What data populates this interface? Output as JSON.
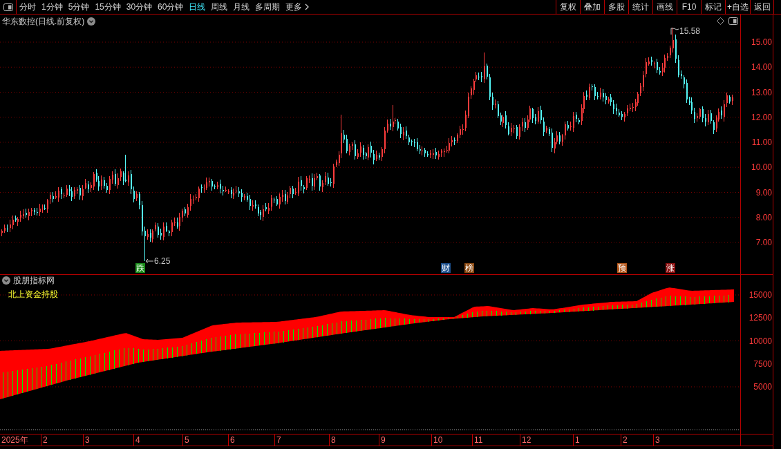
{
  "toolbar": {
    "periods": [
      {
        "label": "分时",
        "selected": false
      },
      {
        "label": "1分钟",
        "selected": false
      },
      {
        "label": "5分钟",
        "selected": false
      },
      {
        "label": "15分钟",
        "selected": false
      },
      {
        "label": "30分钟",
        "selected": false
      },
      {
        "label": "60分钟",
        "selected": false
      },
      {
        "label": "日线",
        "selected": true
      },
      {
        "label": "周线",
        "selected": false
      },
      {
        "label": "月线",
        "selected": false
      },
      {
        "label": "多周期",
        "selected": false
      }
    ],
    "more": "更多",
    "actions": [
      "复权",
      "叠加",
      "多股",
      "统计",
      "画线",
      "F10",
      "标记",
      "+自选",
      "返回"
    ]
  },
  "price_pane": {
    "title": "华东数控(日线.前复权)",
    "axis_labels": [
      "15.00",
      "14.00",
      "13.00",
      "12.00",
      "11.00",
      "10.00",
      "9.00",
      "8.00",
      "7.00"
    ],
    "high_mark": "15.58",
    "low_mark": "6.25",
    "event_badges": [
      {
        "label": "跌",
        "color": "#1a8c1a"
      },
      {
        "label": "财",
        "color": "#1c4f8c"
      },
      {
        "label": "榜",
        "color": "#8c4a12"
      },
      {
        "label": "预",
        "color": "#b4561a"
      },
      {
        "label": "涨",
        "color": "#8c1010"
      }
    ]
  },
  "indicator_pane": {
    "source": "股朋指标网",
    "indicator": "北上资金持股",
    "axis_labels": [
      "15000",
      "12500",
      "10000",
      "7500",
      "5000"
    ]
  },
  "time_axis": [
    "2025年",
    "2",
    "3",
    "4",
    "5",
    "6",
    "7",
    "8",
    "9",
    "10",
    "11",
    "12",
    "1",
    "2",
    "3"
  ]
}
